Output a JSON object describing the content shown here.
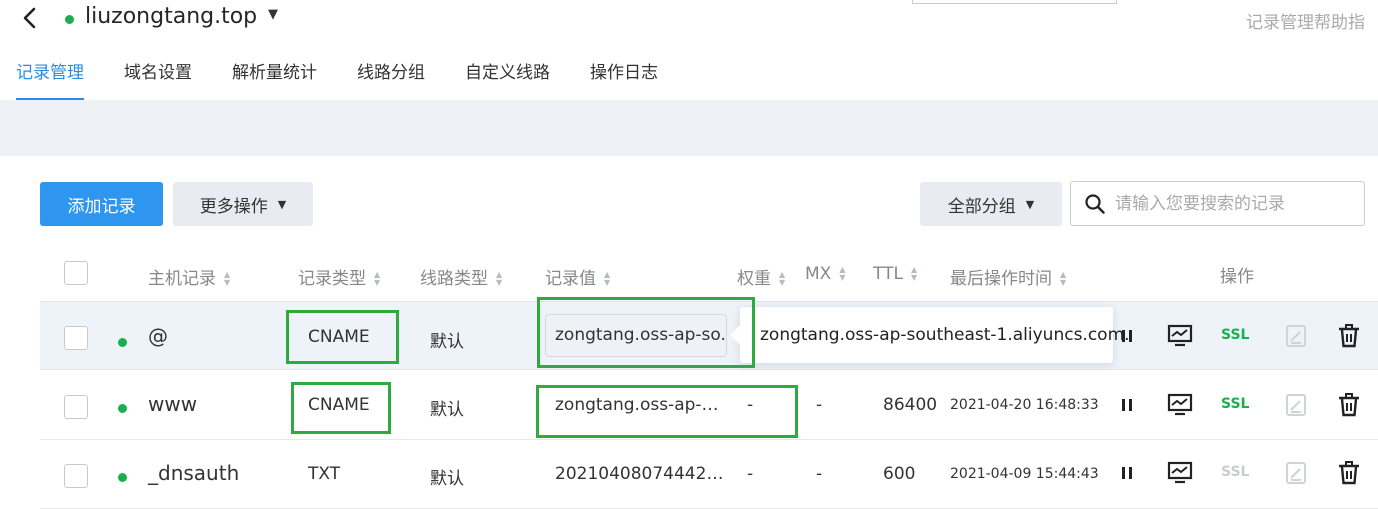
{
  "header": {
    "domain": "liuzongtang.top",
    "help_link": "记录管理帮助指"
  },
  "tabs": [
    {
      "label": "记录管理",
      "active": true
    },
    {
      "label": "域名设置"
    },
    {
      "label": "解析量统计"
    },
    {
      "label": "线路分组"
    },
    {
      "label": "自定义线路"
    },
    {
      "label": "操作日志"
    }
  ],
  "toolbar": {
    "add_label": "添加记录",
    "more_label": "更多操作",
    "group_label": "全部分组",
    "search_placeholder": "请输入您要搜索的记录"
  },
  "columns": {
    "host": "主机记录",
    "type": "记录类型",
    "line": "线路类型",
    "value": "记录值",
    "weight": "权重",
    "mx": "MX",
    "ttl": "TTL",
    "time": "最后操作时间",
    "action": "操作"
  },
  "records": [
    {
      "host": "@",
      "type": "CNAME",
      "line": "默认",
      "value": "zongtang.oss-ap-so...",
      "weight": "",
      "mx": "",
      "ttl": "",
      "time": "",
      "ssl": "SSL",
      "ssl_active": true
    },
    {
      "host": "www",
      "type": "CNAME",
      "line": "默认",
      "value": "zongtang.oss-ap-so...",
      "weight": "-",
      "mx": "-",
      "ttl": "86400",
      "time": "2021-04-20 16:48:33",
      "ssl": "SSL",
      "ssl_active": true
    },
    {
      "host": "_dnsauth",
      "type": "TXT",
      "line": "默认",
      "value": "202104080744425at...",
      "weight": "-",
      "mx": "-",
      "ttl": "600",
      "time": "2021-04-09 15:44:43",
      "ssl": "SSL",
      "ssl_active": false
    }
  ],
  "tooltip": {
    "text": "zongtang.oss-ap-southeast-1.aliyuncs.com."
  },
  "colors": {
    "accent": "#2a8cea",
    "status_on": "#1cae4e",
    "highlight": "#2eaa3e"
  }
}
